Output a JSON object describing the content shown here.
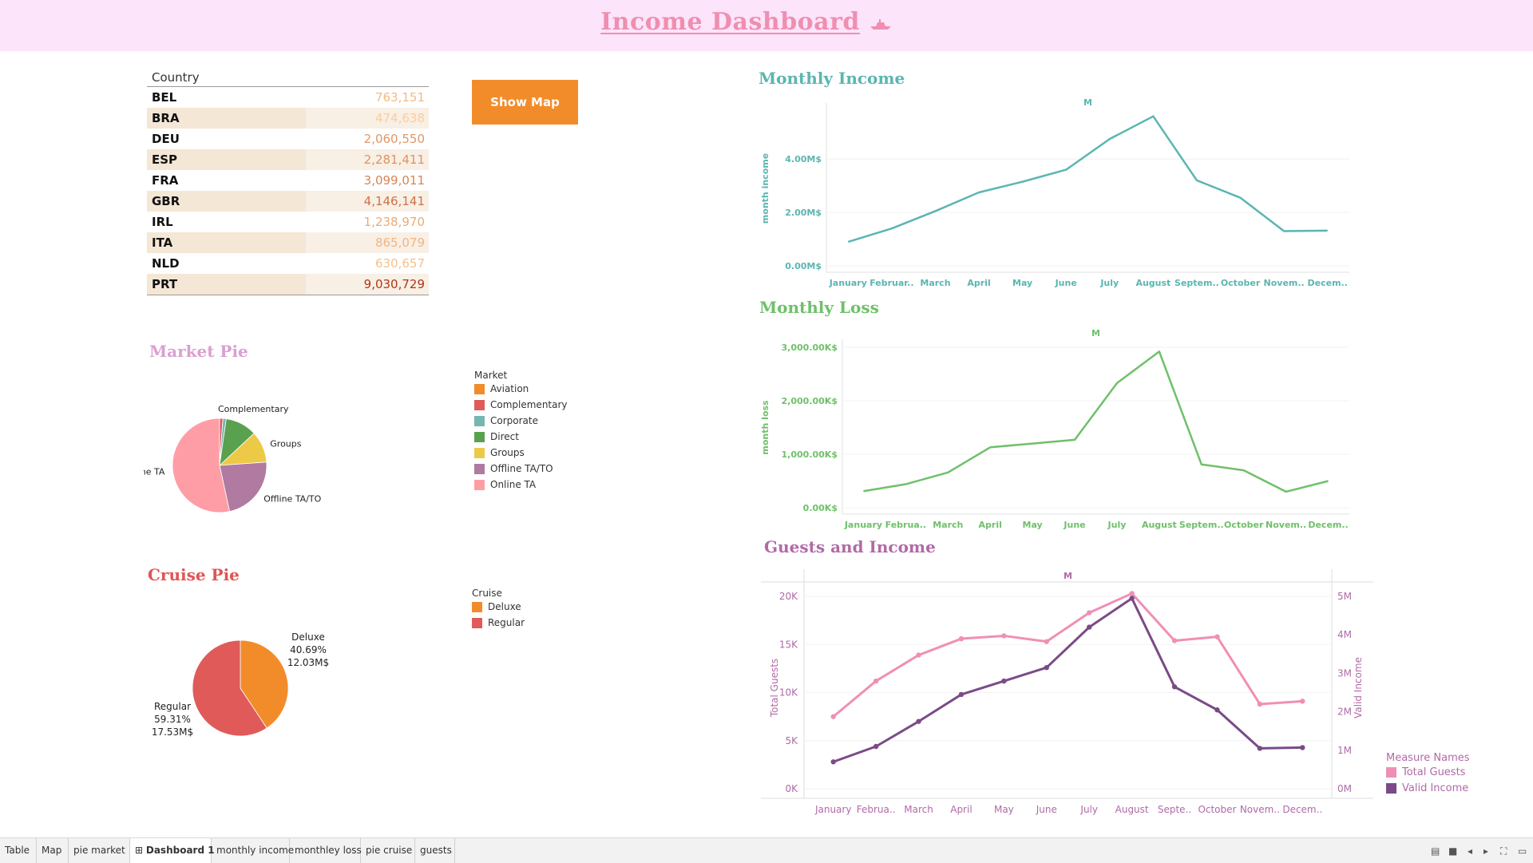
{
  "header": {
    "title": "Income Dashboard",
    "title_color": "#ef8fb0",
    "bg": "#fce4fb"
  },
  "country_table": {
    "header": "Country",
    "rows": [
      {
        "code": "BEL",
        "value": "763,151"
      },
      {
        "code": "BRA",
        "value": "474,638"
      },
      {
        "code": "DEU",
        "value": "2,060,550"
      },
      {
        "code": "ESP",
        "value": "2,281,411"
      },
      {
        "code": "FRA",
        "value": "3,099,011"
      },
      {
        "code": "GBR",
        "value": "4,146,141"
      },
      {
        "code": "IRL",
        "value": "1,238,970"
      },
      {
        "code": "ITA",
        "value": "865,079"
      },
      {
        "code": "NLD",
        "value": "630,657"
      },
      {
        "code": "PRT",
        "value": "9,030,729"
      }
    ]
  },
  "show_map_button": {
    "label": "Show Map",
    "color": "#f28c2a"
  },
  "market_pie": {
    "title": "Market Pie",
    "title_color": "#d9a0d0",
    "legend_title": "Market",
    "legend": [
      {
        "label": "Aviation",
        "color": "#f28c2a"
      },
      {
        "label": "Complementary",
        "color": "#e05a5a"
      },
      {
        "label": "Corporate",
        "color": "#76b7b2"
      },
      {
        "label": "Direct",
        "color": "#59a14f"
      },
      {
        "label": "Groups",
        "color": "#edc948"
      },
      {
        "label": "Offline TA/TO",
        "color": "#b07aa1"
      },
      {
        "label": "Online TA",
        "color": "#ff9da7"
      }
    ]
  },
  "cruise_pie": {
    "title": "Cruise Pie",
    "title_color": "#e05555",
    "legend_title": "Cruise",
    "legend": [
      {
        "label": "Deluxe",
        "color": "#f28c2a"
      },
      {
        "label": "Regular",
        "color": "#e05a5a"
      }
    ]
  },
  "monthly_income": {
    "title": "Monthly Income",
    "title_color": "#5ab6b0"
  },
  "monthly_loss": {
    "title": "Monthly Loss",
    "title_color": "#6fc06a"
  },
  "guests_income": {
    "title": "Guests and Income",
    "title_color": "#b06aa7",
    "legend_title": "Measure Names",
    "legend": [
      {
        "label": "Total Guests",
        "color": "#f08fb5"
      },
      {
        "label": "Valid Income",
        "color": "#7a4b86"
      }
    ]
  },
  "chart_data": [
    {
      "type": "table",
      "header": "Country",
      "categories": [
        "BEL",
        "BRA",
        "DEU",
        "ESP",
        "FRA",
        "GBR",
        "IRL",
        "ITA",
        "NLD",
        "PRT"
      ],
      "values": [
        763151,
        474638,
        2060550,
        2281411,
        3099011,
        4146141,
        1238970,
        865079,
        630657,
        9030729
      ]
    },
    {
      "type": "pie",
      "title": "Market Pie",
      "categories": [
        "Complementary",
        "Corporate",
        "Direct",
        "Groups",
        "Offline TA/TO",
        "Online TA"
      ],
      "values": [
        1,
        1,
        9.5,
        9.5,
        20,
        47
      ],
      "colors": [
        "#e05a5a",
        "#76b7b2",
        "#59a14f",
        "#edc948",
        "#b07aa1",
        "#ff9da7"
      ],
      "labels": [
        "Complementary",
        "",
        "",
        "Groups",
        "Offline TA/TO",
        "Online TA"
      ]
    },
    {
      "type": "pie",
      "title": "Cruise Pie",
      "categories": [
        "Deluxe",
        "Regular"
      ],
      "values": [
        40.69,
        59.31
      ],
      "colors": [
        "#f28c2a",
        "#e05a5a"
      ],
      "labels": [
        [
          "Deluxe",
          "40.69%",
          "12.03M$"
        ],
        [
          "Regular",
          "59.31%",
          "17.53M$"
        ]
      ]
    },
    {
      "type": "line",
      "title": "Monthly Income",
      "header": "M",
      "ylabel": "month income",
      "categories": [
        "January",
        "Februar..",
        "March",
        "April",
        "May",
        "June",
        "July",
        "August",
        "Septem..",
        "October",
        "Novem..",
        "Decem.."
      ],
      "values": [
        0.9,
        1.4,
        2.05,
        2.75,
        3.15,
        3.6,
        4.75,
        5.6,
        3.2,
        2.55,
        1.3,
        1.32
      ],
      "ylim": [
        0,
        5.8
      ],
      "yticks": [
        0,
        2,
        4
      ],
      "ytick_labels": [
        "0.00M$",
        "2.00M$",
        "4.00M$"
      ],
      "color": "#5ab6b0"
    },
    {
      "type": "line",
      "title": "Monthly Loss",
      "header": "M",
      "ylabel": "month loss",
      "categories": [
        "January",
        "Februa..",
        "March",
        "April",
        "May",
        "June",
        "July",
        "August",
        "Septem..",
        "October",
        "Novem..",
        "Decem.."
      ],
      "values": [
        310,
        440,
        660,
        1130,
        1200,
        1270,
        2330,
        2920,
        810,
        700,
        300,
        500
      ],
      "ylim": [
        0,
        3000
      ],
      "yticks": [
        0,
        1000,
        2000,
        3000
      ],
      "ytick_labels": [
        "0.00K$",
        "1,000.00K$",
        "2,000.00K$",
        "3,000.00K$"
      ],
      "color": "#6fc06a"
    },
    {
      "type": "line",
      "title": "Guests and Income",
      "header": "M",
      "categories": [
        "January",
        "Februa..",
        "March",
        "April",
        "May",
        "June",
        "July",
        "August",
        "Septe..",
        "October",
        "Novem..",
        "Decem.."
      ],
      "series": [
        {
          "name": "Total Guests",
          "axis": "left",
          "values": [
            7500,
            11200,
            13900,
            15600,
            15900,
            15300,
            18300,
            20300,
            15400,
            15800,
            8800,
            9100
          ],
          "color": "#f08fb5"
        },
        {
          "name": "Valid Income",
          "axis": "right",
          "values": [
            0.7,
            1.1,
            1.75,
            2.45,
            2.8,
            3.15,
            4.2,
            4.95,
            2.65,
            2.05,
            1.05,
            1.07
          ],
          "color": "#7a4b86"
        }
      ],
      "ylabel": "Total Guests",
      "ylabel_right": "Valid Income",
      "ylim": [
        0,
        21000
      ],
      "yticks": [
        0,
        5000,
        10000,
        15000,
        20000
      ],
      "ytick_labels": [
        "0K",
        "5K",
        "10K",
        "15K",
        "20K"
      ],
      "ylim_right": [
        0,
        5.25
      ],
      "yticks_right": [
        0,
        1,
        2,
        3,
        4,
        5
      ],
      "ytick_labels_right": [
        "0M",
        "1M",
        "2M",
        "3M",
        "4M",
        "5M"
      ]
    }
  ],
  "tabs": [
    {
      "label": "Table",
      "active": false
    },
    {
      "label": "Map",
      "active": false
    },
    {
      "label": "pie market",
      "active": false
    },
    {
      "label": "Dashboard 1",
      "active": true,
      "icon": "grid-icon"
    },
    {
      "label": "monthly income",
      "active": false
    },
    {
      "label": "monthley loss",
      "active": false
    },
    {
      "label": "pie cruise",
      "active": false
    },
    {
      "label": "guests",
      "active": false
    }
  ],
  "view_controls": [
    "grid-view-icon",
    "list-view-icon",
    "prev-icon",
    "next-icon",
    "fullscreen-icon",
    "present-icon"
  ]
}
